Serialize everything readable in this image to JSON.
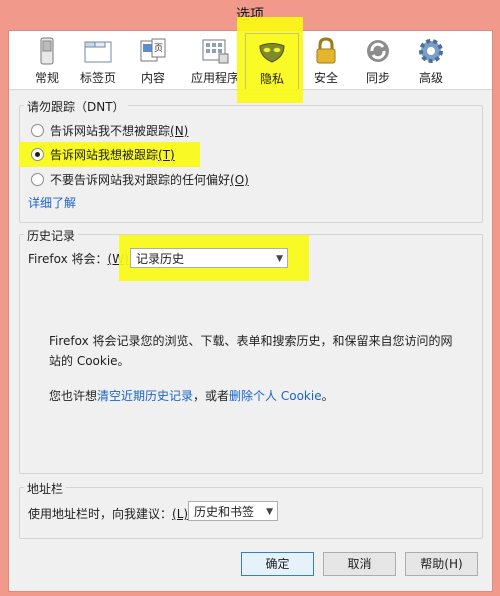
{
  "window": {
    "title": "选项"
  },
  "toolbar": {
    "items": [
      {
        "label": "常规",
        "icon": "switch-icon"
      },
      {
        "label": "标签页",
        "icon": "tabs-window-icon"
      },
      {
        "label": "内容",
        "icon": "content-page-icon"
      },
      {
        "label": "应用程序",
        "icon": "applications-icon"
      },
      {
        "label": "隐私",
        "icon": "mask-icon"
      },
      {
        "label": "安全",
        "icon": "padlock-icon"
      },
      {
        "label": "同步",
        "icon": "sync-icon"
      },
      {
        "label": "高级",
        "icon": "gear-icon"
      }
    ],
    "selected": "隐私"
  },
  "tracking": {
    "title": "请勿跟踪（DNT）",
    "options": [
      {
        "label": "告诉网站我不想被跟踪",
        "key": "(N)",
        "checked": false
      },
      {
        "label": "告诉网站我想被跟踪",
        "key": "(T)",
        "checked": true
      },
      {
        "label": "不要告诉网站我对跟踪的任何偏好",
        "key": "(O)",
        "checked": false
      }
    ],
    "learn_more": "详细了解"
  },
  "history": {
    "title": "历史记录",
    "firefox_will": "Firefox 将会：",
    "firefox_key": "(W)",
    "selected": "记录历史",
    "description": "Firefox 将会记录您的浏览、下载、表单和搜索历史，和保留来自您访问的网站的 Cookie。",
    "clear_prefix": "您也许想",
    "clear_link": "清空近期历史记录",
    "clear_middle": "，或者",
    "delete_link": "删除个人 Cookie",
    "clear_suffix": "。"
  },
  "location_bar": {
    "title": "地址栏",
    "label": "使用地址栏时，向我建议：",
    "key": "(L)",
    "selected": "历史和书签"
  },
  "buttons": {
    "ok": "确定",
    "cancel": "取消",
    "help": "帮助(H)"
  },
  "colors": {
    "window_frame": "#f19a8c",
    "highlight": "#f5f500",
    "link": "#1a64c8"
  }
}
